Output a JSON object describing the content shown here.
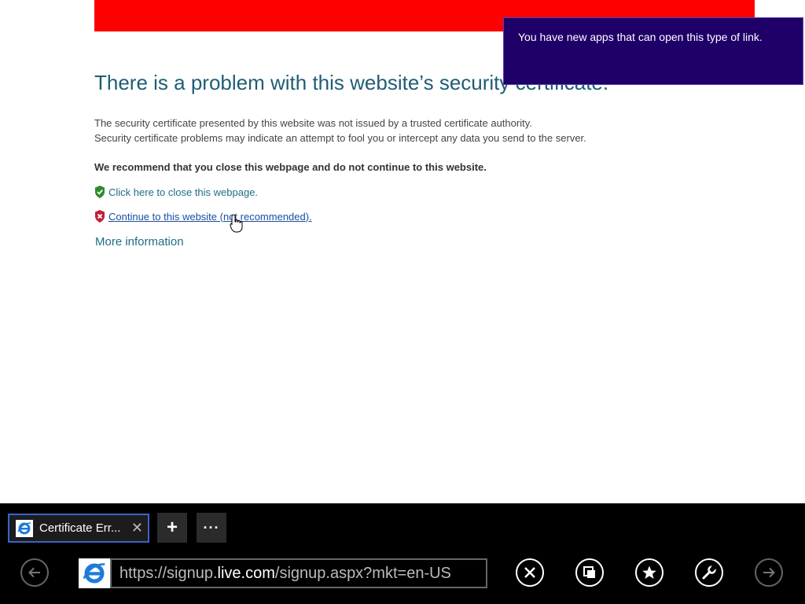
{
  "page": {
    "title": "There is a problem with this website’s security certificate.",
    "description_line1": "The security certificate presented by this website was not issued by a trusted certificate authority.",
    "description_line2": "Security certificate problems may indicate an attempt to fool you or intercept any data you send to the server.",
    "recommendation": "We recommend that you close this webpage and do not continue to this website.",
    "close_link": "Click here to close this webpage.",
    "continue_link": "Continue to this website (not recommended).",
    "more_info": "More information",
    "banner_color": "#ff0000"
  },
  "toast": {
    "message": "You have new apps that can open this type of link."
  },
  "tabs": [
    {
      "title": "Certificate Err...",
      "icon": "ie-icon",
      "active": true
    }
  ],
  "appbar": {
    "new_tab_label": "+",
    "tab_menu_label": "···",
    "address_prefix": "https://signup.",
    "address_host": "live.com",
    "address_suffix": "/signup.aspx?mkt=en-US",
    "buttons": [
      "back-icon",
      "stop-icon",
      "tabs-icon",
      "favorite-icon",
      "tools-icon",
      "forward-icon"
    ]
  },
  "colors": {
    "accent": "#1f5d75",
    "link": "#1f6e84",
    "toast_bg": "#1f0068",
    "tab_border": "#3a64c8"
  }
}
